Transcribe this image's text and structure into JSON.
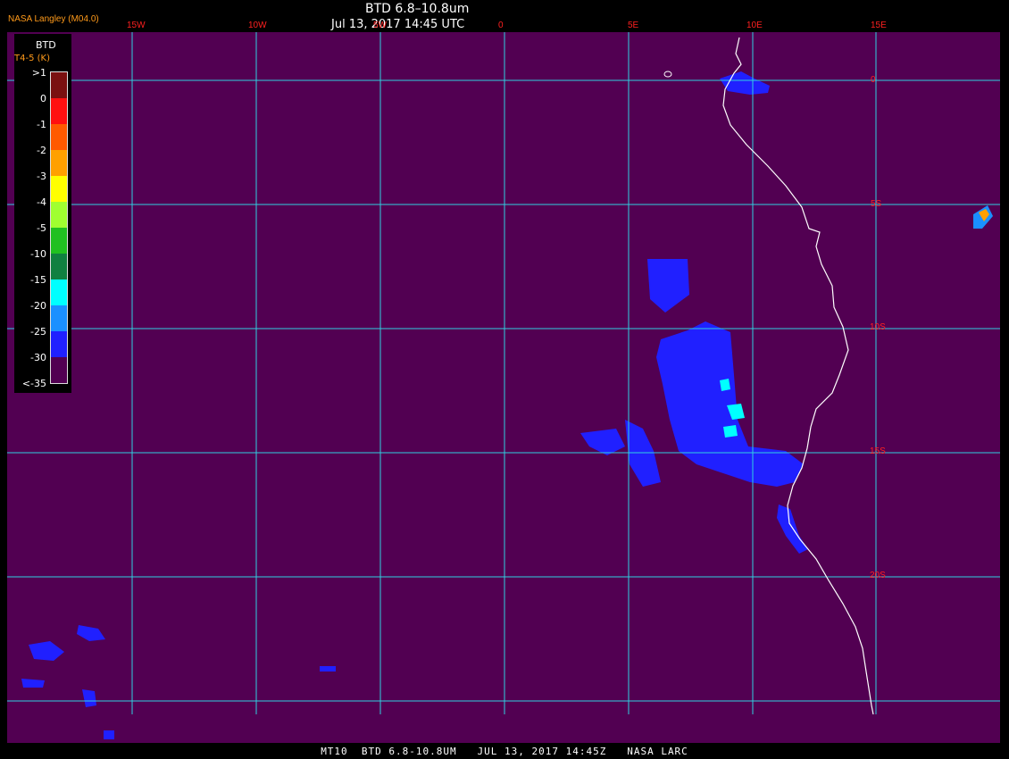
{
  "header": {
    "organization": "NASA Langley (M04.0)",
    "title": "BTD 6.8–10.8um",
    "datetime": "Jul 13, 2017 14:45 UTC"
  },
  "footer": {
    "text": "MT10  BTD 6.8-10.8UM   JUL 13, 2017 14:45Z   NASA LARC"
  },
  "legend": {
    "title": "BTD",
    "subtitle": "T4-5 (K)",
    "entries": [
      {
        "label": ">1",
        "color": "#7a1010"
      },
      {
        "label": "0",
        "color": "#ff1010"
      },
      {
        "label": "-1",
        "color": "#ff5a00"
      },
      {
        "label": "-2",
        "color": "#ffa000"
      },
      {
        "label": "-3",
        "color": "#ffff00"
      },
      {
        "label": "-4",
        "color": "#a0ff30"
      },
      {
        "label": "-5",
        "color": "#20c020"
      },
      {
        "label": "-10",
        "color": "#108040"
      },
      {
        "label": "-15",
        "color": "#00ffff"
      },
      {
        "label": "-20",
        "color": "#1a90ff"
      },
      {
        "label": "-25",
        "color": "#2020ff"
      },
      {
        "label": "-30",
        "color": "#520052"
      },
      {
        "label": "<-35",
        "color": null
      }
    ]
  },
  "grid": {
    "longitudes": [
      "15W",
      "10W",
      "5W",
      "0",
      "5E",
      "10E",
      "15E"
    ],
    "latitudes": [
      "0",
      "5S",
      "10S",
      "15S",
      "20S"
    ],
    "line_color": "#30d0e0"
  },
  "colors": {
    "background": "#520052",
    "coastline": "#ffffff",
    "cloud_cold": "#2020ff",
    "label_red": "#ff2020"
  }
}
